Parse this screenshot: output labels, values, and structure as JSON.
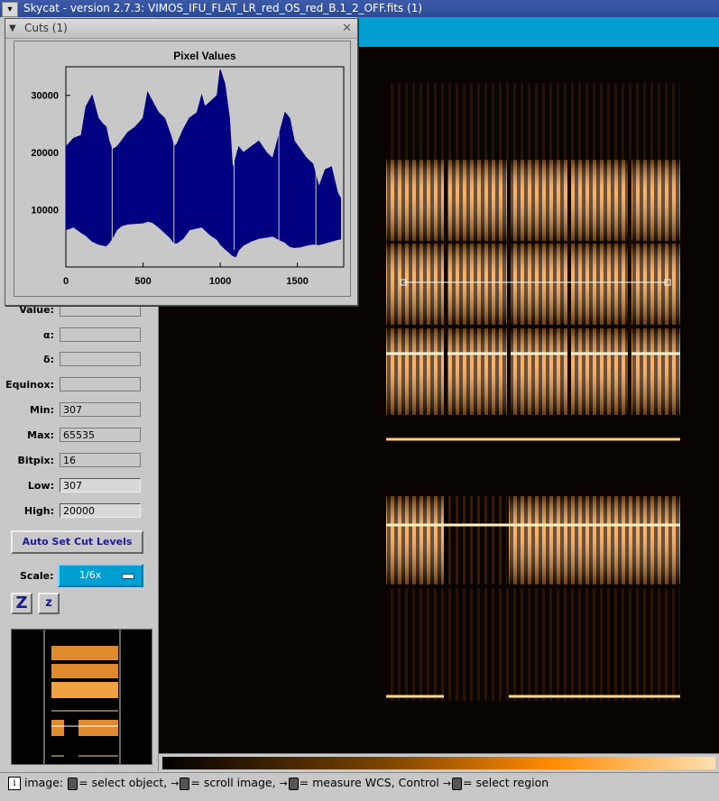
{
  "window": {
    "title": "Skycat - version 2.7.3: VIMOS_IFU_FLAT_LR_red_OS_red_B.1_2_OFF.fits (1)",
    "menu_icon": "chevron-down-icon"
  },
  "cuts_window": {
    "title": "Cuts (1)",
    "collapse_icon": "chevron-down-icon",
    "close_icon": "close-icon"
  },
  "info_panel": {
    "rows": [
      {
        "label": "Value:",
        "value": ""
      },
      {
        "label": "α:",
        "value": ""
      },
      {
        "label": "δ:",
        "value": ""
      },
      {
        "label": "Equinox:",
        "value": ""
      },
      {
        "label": "Min:",
        "value": "307"
      },
      {
        "label": "Max:",
        "value": "65535"
      },
      {
        "label": "Bitpix:",
        "value": "16"
      },
      {
        "label": "Low:",
        "value": "307"
      },
      {
        "label": "High:",
        "value": "20000"
      }
    ],
    "auto_cut_label": "Auto Set Cut Levels",
    "scale_label": "Scale:",
    "scale_value": "1/6x",
    "zoom_in_label": "Z",
    "zoom_out_label": "z"
  },
  "statusbar": {
    "prefix": "image:",
    "seg1": "= select object,",
    "seg2": "= scroll image,",
    "seg3": "= measure WCS, Control",
    "seg4": "= select region"
  },
  "colors": {
    "accent_blue": "#00a0d2",
    "plot_line": "#000080",
    "title_bar": "#2a4a96"
  },
  "chart_data": {
    "type": "area",
    "title": "Pixel Values",
    "xlabel": "",
    "ylabel": "",
    "xlim": [
      0,
      1800
    ],
    "ylim": [
      0,
      35000
    ],
    "x_ticks": [
      0,
      500,
      1000,
      1500
    ],
    "y_ticks": [
      10000,
      20000,
      30000
    ],
    "series": [
      {
        "x": [
          0,
          50,
          100,
          130,
          170,
          210,
          240,
          260,
          280,
          300,
          330,
          360,
          400,
          450,
          500,
          530,
          560,
          600,
          640,
          680,
          700,
          720,
          760,
          800,
          850,
          880,
          900,
          940,
          980,
          1000,
          1030,
          1060,
          1080,
          1100,
          1120,
          1150,
          1200,
          1250,
          1300,
          1340,
          1380,
          1420,
          1450,
          1480,
          1520,
          1560,
          1600,
          1640,
          1680,
          1720,
          1760,
          1780
        ],
        "y_top": [
          21000,
          22500,
          23000,
          28000,
          30000,
          26000,
          25000,
          24500,
          22000,
          20500,
          21000,
          22000,
          23500,
          24500,
          26000,
          30500,
          29000,
          27000,
          26000,
          23000,
          21000,
          21500,
          24000,
          26000,
          27000,
          30000,
          28000,
          29000,
          30000,
          34500,
          32000,
          26000,
          17000,
          19000,
          21000,
          20000,
          21000,
          22000,
          20000,
          19000,
          23000,
          27000,
          26000,
          22000,
          20500,
          19000,
          18000,
          14000,
          17000,
          17500,
          13000,
          12000
        ],
        "y_bottom": [
          6500,
          7000,
          6000,
          5500,
          4500,
          4000,
          3800,
          3700,
          4200,
          5000,
          6500,
          7200,
          7500,
          7600,
          7700,
          8000,
          7800,
          7000,
          6000,
          5000,
          4200,
          4200,
          5000,
          6500,
          6800,
          7000,
          6500,
          5500,
          4800,
          4000,
          3200,
          2500,
          2000,
          1800,
          3000,
          3800,
          4500,
          5000,
          5200,
          5400,
          4800,
          4300,
          3600,
          3400,
          3500,
          3800,
          4000,
          3900,
          4200,
          4500,
          4800,
          4900
        ]
      }
    ]
  }
}
